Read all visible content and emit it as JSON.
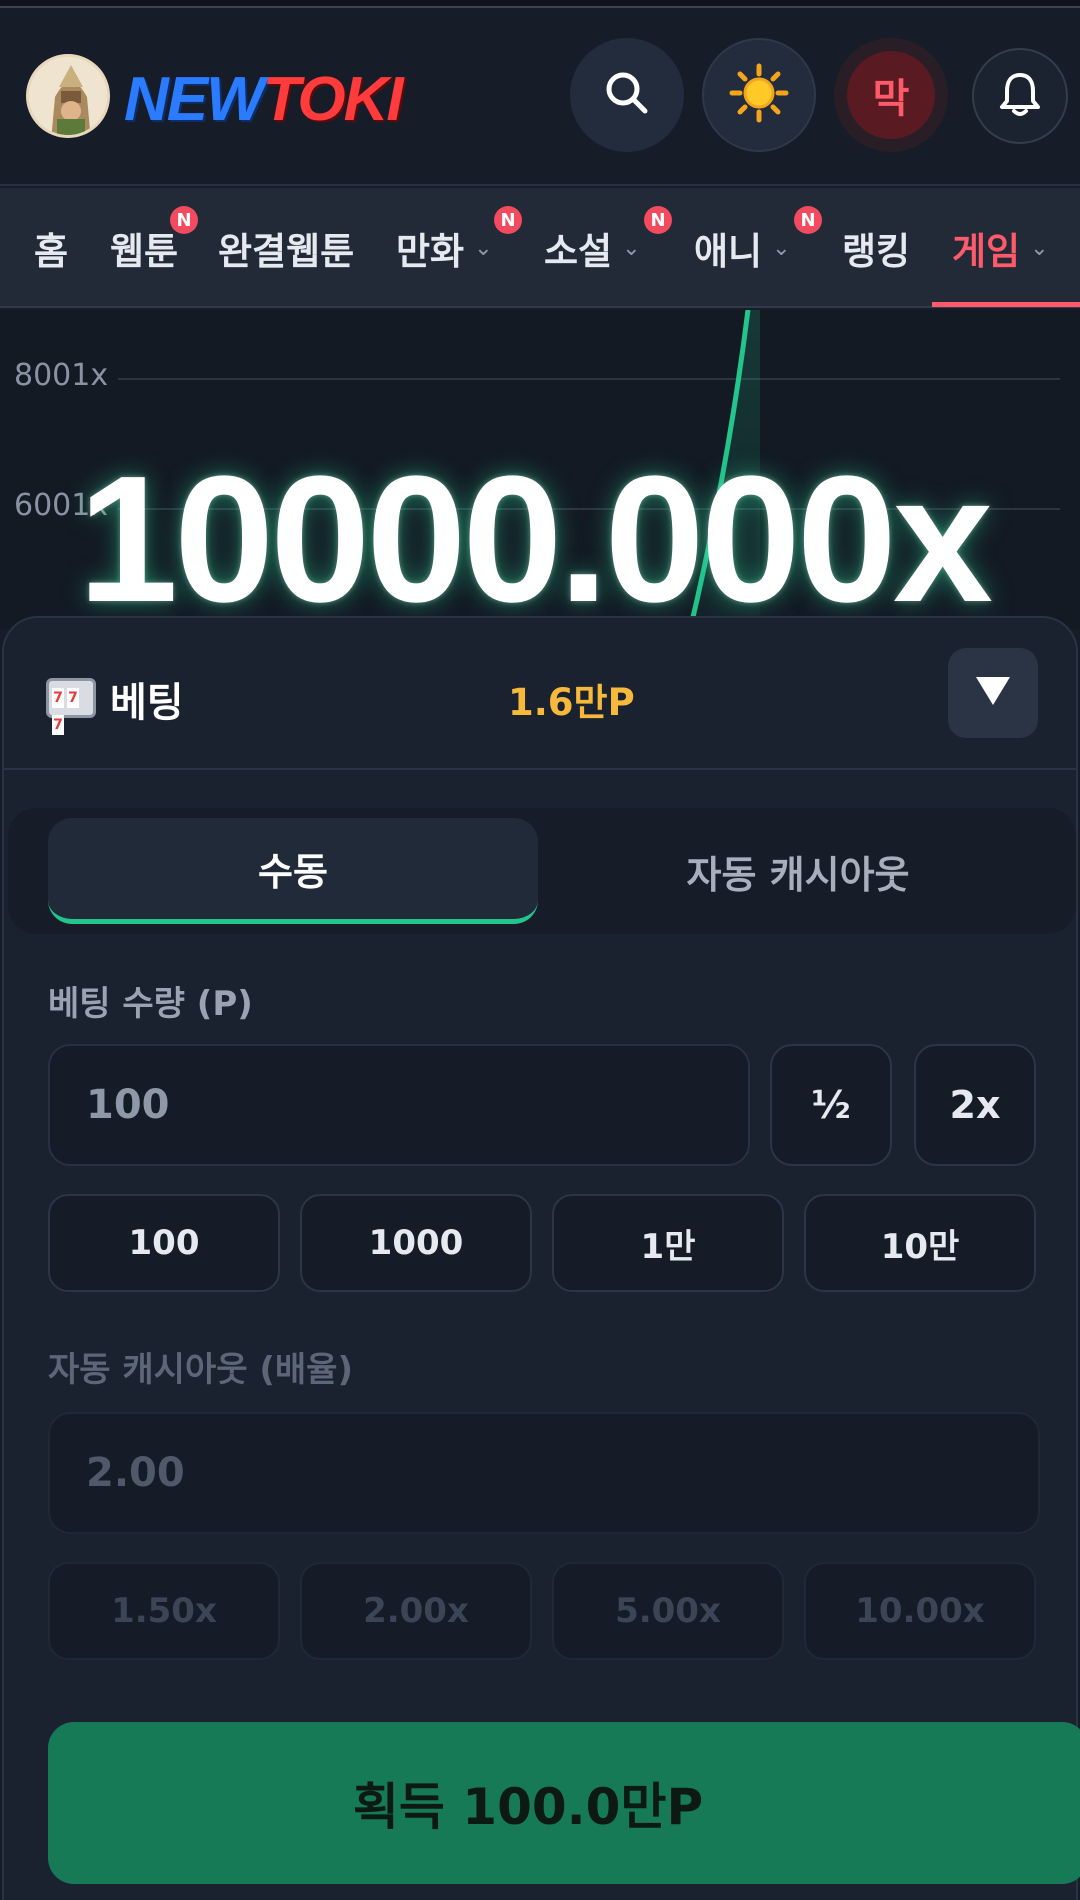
{
  "header": {
    "logo_new": "NEW",
    "logo_toki": "TOKI",
    "user_initial": "막"
  },
  "nav": {
    "items": [
      {
        "label": "홈",
        "badge": "",
        "dropdown": false
      },
      {
        "label": "웹툰",
        "badge": "N",
        "dropdown": false
      },
      {
        "label": "완결웹툰",
        "badge": "",
        "dropdown": false
      },
      {
        "label": "만화",
        "badge": "N",
        "dropdown": true
      },
      {
        "label": "소설",
        "badge": "N",
        "dropdown": true
      },
      {
        "label": "애니",
        "badge": "N",
        "dropdown": true
      },
      {
        "label": "랭킹",
        "badge": "",
        "dropdown": false
      },
      {
        "label": "게임",
        "badge": "",
        "dropdown": true,
        "active": true
      }
    ]
  },
  "game": {
    "tick_upper": "8001x",
    "tick_lower": "6001x",
    "multiplier": "10000.000x",
    "line_color": "#22c58b"
  },
  "bet": {
    "title": "베팅",
    "points": "1.6만P",
    "tabs": {
      "manual": "수동",
      "auto": "자동 캐시아웃"
    },
    "amount_label": "베팅 수량 (P)",
    "amount_value": "100",
    "half_label": "½",
    "double_label": "2x",
    "quick_amounts": [
      "100",
      "1000",
      "1만",
      "10만"
    ],
    "auto_label": "자동 캐시아웃 (배율)",
    "auto_value": "2.00",
    "auto_presets": [
      "1.50x",
      "2.00x",
      "5.00x",
      "10.00x"
    ],
    "cta_label": "획득 100.0만P",
    "colors": {
      "accent": "#22c58b",
      "points": "#f6b93b",
      "active_nav": "#ff5a6a",
      "cta_bg": "#177a56"
    }
  }
}
